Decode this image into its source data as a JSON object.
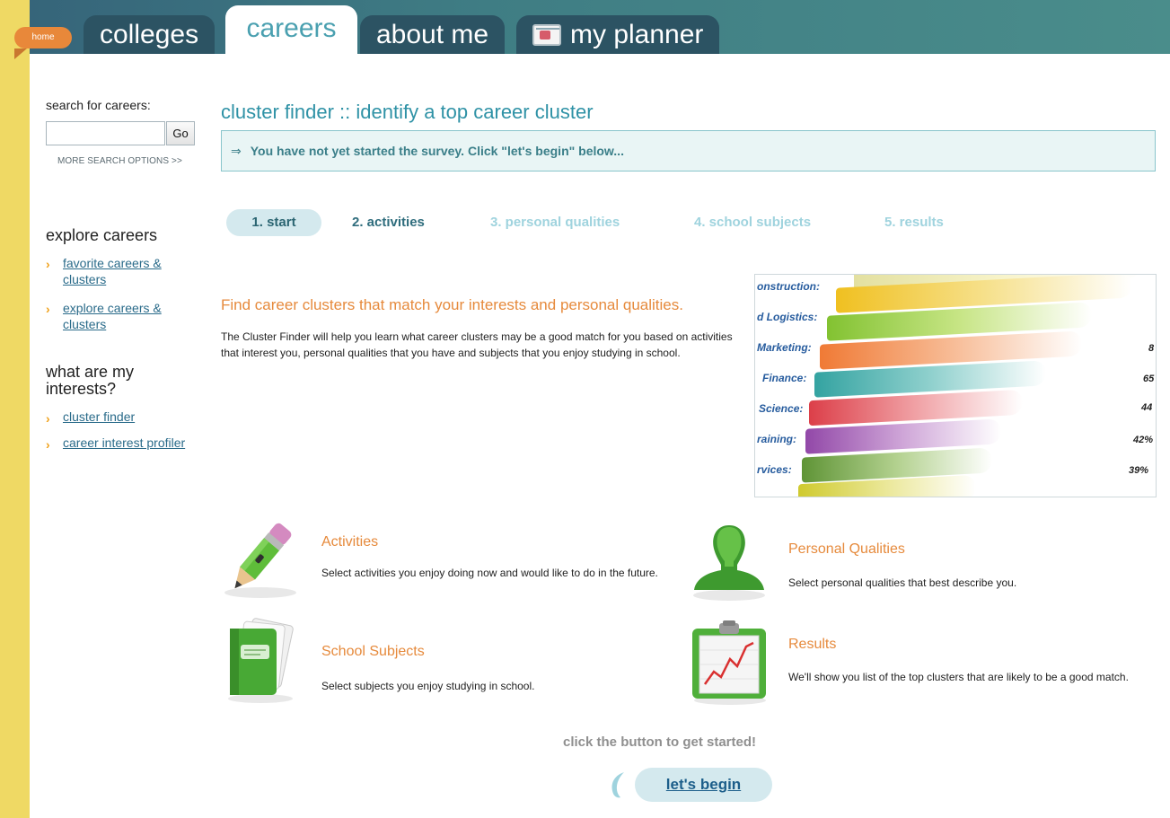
{
  "nav": {
    "home_label": "home",
    "tabs": [
      {
        "label": "colleges"
      },
      {
        "label": "careers"
      },
      {
        "label": "about me"
      },
      {
        "label": "my planner"
      }
    ],
    "active_tab": "careers"
  },
  "sidebar": {
    "search_label": "search for careers:",
    "search_placeholder": "",
    "go_label": "Go",
    "more_options": "MORE SEARCH OPTIONS >>",
    "explore_heading": "explore careers",
    "explore_links": [
      {
        "line1": "favorite careers &",
        "line2": "clusters"
      },
      {
        "line1": "explore careers &",
        "line2": "clusters"
      }
    ],
    "interests_heading_1": "what are my",
    "interests_heading_2": "interests?",
    "interest_links": [
      "cluster finder",
      "career interest profiler"
    ]
  },
  "main": {
    "title": "cluster finder :: identify a top career cluster",
    "notice_arrow": "⇒",
    "notice": "You have not yet started the survey. Click \"let's begin\" below...",
    "steps": [
      "1. start",
      "2. activities",
      "3. personal qualities",
      "4. school subjects",
      "5. results"
    ],
    "intro_heading": "Find career clusters that match your interests and personal qualities.",
    "intro_text": "The Cluster Finder will help you learn what career clusters may be a good match for you based on activities that interest you, personal qualities that you have and subjects that you enjoy studying in school.",
    "hero": {
      "labels": [
        "onstruction:",
        "d Logistics:",
        "Marketing:",
        "Finance:",
        "Science:",
        "raining:",
        "rvices:"
      ],
      "percents": [
        "8",
        "65",
        "44",
        "42%",
        "39%"
      ],
      "colors": [
        "#f1d23a",
        "#8cc83c",
        "#f0874a",
        "#3aa9a6",
        "#e04b54",
        "#9a55ad",
        "#6b9e3c",
        "#d9d23a"
      ]
    },
    "features": [
      {
        "title": "Activities",
        "text": "Select activities you enjoy doing now and would like to do in the future.",
        "icon": "pencil-icon"
      },
      {
        "title": "Personal Qualities",
        "text": "Select personal qualities that best describe you.",
        "icon": "person-icon"
      },
      {
        "title": "School Subjects",
        "text": "Select subjects you enjoy studying in school.",
        "icon": "notebook-icon"
      },
      {
        "title": "Results",
        "text": "We'll show you list of the top clusters that are likely to be a good match.",
        "icon": "chart-clipboard-icon"
      }
    ],
    "cta_text": "click the button to get started!",
    "cta_button": "let's begin"
  }
}
